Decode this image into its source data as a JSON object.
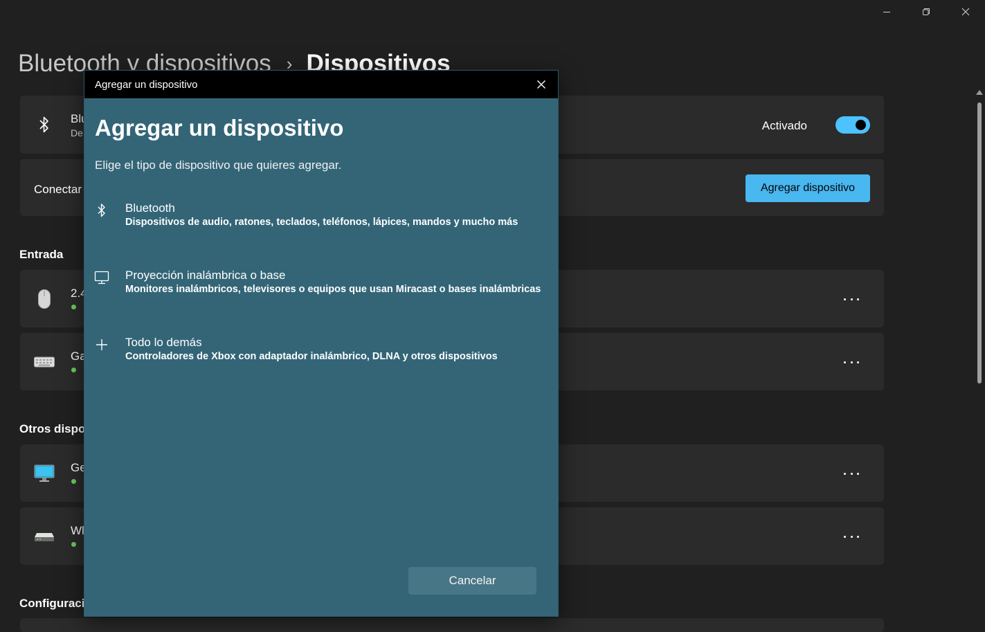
{
  "breadcrumb": {
    "parent": "Bluetooth y dispositivos",
    "separator": "›",
    "current": "Dispositivos"
  },
  "bluetooth_card": {
    "name": "Blu",
    "sub": "De",
    "toggle_label": "Activado",
    "toggle_on": true
  },
  "connect_card": {
    "label": "Conectar",
    "button": "Agregar dispositivo"
  },
  "sections": {
    "entrada": "Entrada",
    "otros": "Otros dispo",
    "config": "Configuraci"
  },
  "devices": [
    {
      "name": "2.4",
      "icon": "mouse-icon",
      "connected": true
    },
    {
      "name": "Ga",
      "icon": "keyboard-icon",
      "connected": true
    },
    {
      "name": "Ge",
      "icon": "monitor-icon",
      "connected": true
    },
    {
      "name": "Wl",
      "icon": "router-icon",
      "connected": true
    }
  ],
  "dialog": {
    "titlebar": "Agregar un dispositivo",
    "heading": "Agregar un dispositivo",
    "description": "Elige el tipo de dispositivo que quieres agregar.",
    "options": [
      {
        "icon": "bluetooth-icon",
        "title": "Bluetooth",
        "desc": "Dispositivos de audio, ratones, teclados, teléfonos, lápices, mandos y mucho más"
      },
      {
        "icon": "display-icon",
        "title": "Proyección inalámbrica o base",
        "desc": "Monitores inalámbricos, televisores o equipos que usan Miracast o bases inalámbricas"
      },
      {
        "icon": "plus-icon",
        "title": "Todo lo demás",
        "desc": "Controladores de Xbox con adaptador inalámbrico, DLNA y otros dispositivos"
      }
    ],
    "cancel": "Cancelar"
  },
  "colors": {
    "background": "#202020",
    "card": "#2b2b2b",
    "accent": "#4cc2ff",
    "dialog": "#336577",
    "status_connected": "#6ccb5f"
  }
}
